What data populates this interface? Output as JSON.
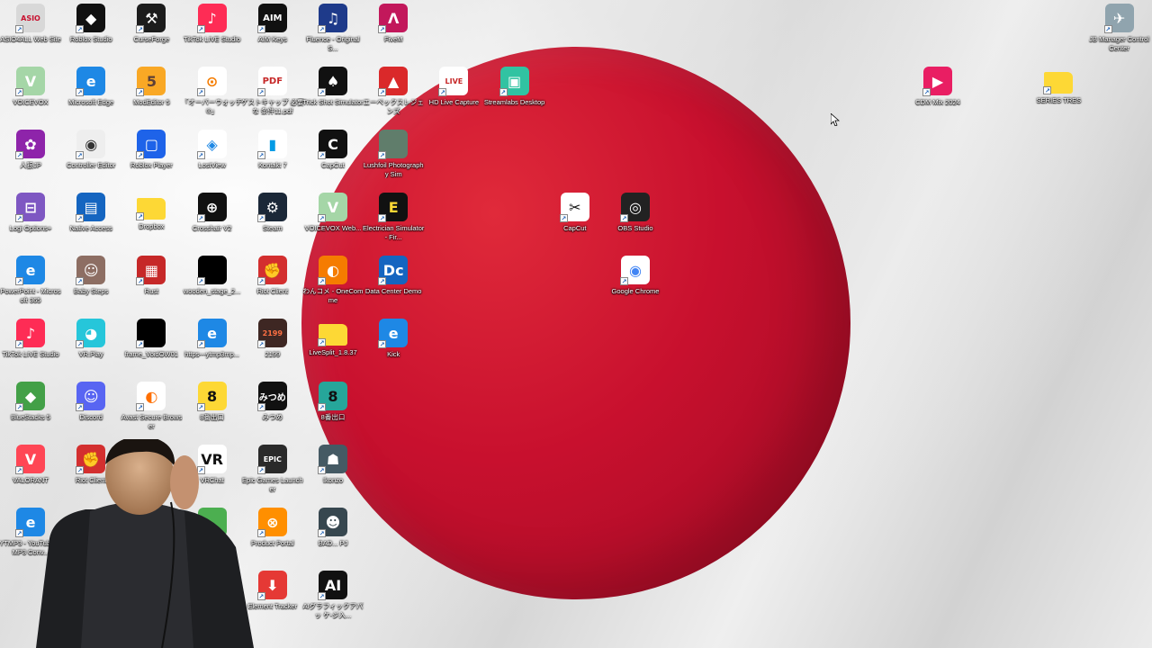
{
  "desktop": {
    "background": {
      "field_color": "#eeeeee",
      "sun_color": "#c8102e"
    },
    "icons": [
      {
        "id": "asio",
        "label": "ASIO4ALL Web Site",
        "bg": "#d8d8d8",
        "fg": "#c8102e",
        "glyph": "ASIO"
      },
      {
        "id": "roblox-studio",
        "label": "Roblox Studio",
        "bg": "#111111",
        "fg": "#ffffff",
        "glyph": "◆"
      },
      {
        "id": "curseforge",
        "label": "CurseForge",
        "bg": "#1c1c1c",
        "fg": "#ffffff",
        "glyph": "⚒"
      },
      {
        "id": "tiktok-live-studio-1",
        "label": "TikTok LIVE Studio",
        "bg": "#fe2c55",
        "fg": "#ffffff",
        "glyph": "♪"
      },
      {
        "id": "aim-keys",
        "label": "AIM Keys",
        "bg": "#111111",
        "fg": "#ffffff",
        "glyph": "AIM"
      },
      {
        "id": "fluence",
        "label": "Fluence - Original S...",
        "bg": "#1e3a8a",
        "fg": "#ffffff",
        "glyph": "♫"
      },
      {
        "id": "fiveM",
        "label": "FiveM",
        "bg": "#c2185b",
        "fg": "#ffffff",
        "glyph": "Λ"
      },
      {
        "id": "voicevox-1",
        "label": "VOICEVOX",
        "bg": "#a5d6a7",
        "fg": "#ffffff",
        "glyph": "V"
      },
      {
        "id": "msedge-1",
        "label": "Microsoft Edge",
        "bg": "#1e88e5",
        "fg": "#ffffff",
        "glyph": "e"
      },
      {
        "id": "modeditor",
        "label": "ModEditor 5",
        "bg": "#f9a825",
        "fg": "#5d4037",
        "glyph": "5"
      },
      {
        "id": "overwatch",
        "label": "「オーバーウォッチ®」",
        "bg": "#ffffff",
        "fg": "#f57c00",
        "glyph": "⊙"
      },
      {
        "id": "pdf",
        "label": "ゲストキャップ 必要な 条件11.pdf",
        "bg": "#ffffff",
        "fg": "#c62828",
        "glyph": "PDF"
      },
      {
        "id": "trickshot",
        "label": "Trick Shot Simulator",
        "bg": "#111111",
        "fg": "#ffffff",
        "glyph": "♠"
      },
      {
        "id": "apex",
        "label": "エーペックスレジェンズ",
        "bg": "#da292a",
        "fg": "#ffffff",
        "glyph": "▲"
      },
      {
        "id": "hd-live",
        "label": "HD Live Capture",
        "bg": "#ffffff",
        "fg": "#c62828",
        "glyph": "LIVE"
      },
      {
        "id": "streamlabs",
        "label": "Streamlabs Desktop",
        "bg": "#31c3a2",
        "fg": "#ffffff",
        "glyph": "▣"
      },
      {
        "id": "jinroujp",
        "label": "人狼JP",
        "bg": "#8e24aa",
        "fg": "#ffffff",
        "glyph": "✿"
      },
      {
        "id": "controller-editor",
        "label": "Controller Editor",
        "bg": "#eeeeee",
        "fg": "#333333",
        "glyph": "◉"
      },
      {
        "id": "roblox-player",
        "label": "Roblox Player",
        "bg": "#1e63e9",
        "fg": "#ffffff",
        "glyph": "▢"
      },
      {
        "id": "lostview",
        "label": "LostView",
        "bg": "#ffffff",
        "fg": "#1e88e5",
        "glyph": "◈"
      },
      {
        "id": "kontakt",
        "label": "Kontakt 7",
        "bg": "#ffffff",
        "fg": "#039be5",
        "glyph": "▮"
      },
      {
        "id": "capcut-green",
        "label": "CapCut",
        "bg": "#111111",
        "fg": "#ffffff",
        "glyph": "C"
      },
      {
        "id": "lushfoil",
        "label": "Lushfoil Photography Sim",
        "bg": "#607d6b",
        "fg": "#ffffff",
        "glyph": ""
      },
      {
        "id": "logi-options",
        "label": "Logi Options+",
        "bg": "#7e57c2",
        "fg": "#ffffff",
        "glyph": "⊟"
      },
      {
        "id": "native-access",
        "label": "Native Access",
        "bg": "#1565c0",
        "fg": "#ffffff",
        "glyph": "▤"
      },
      {
        "id": "dropbox-folder",
        "label": "Dropbox",
        "bg": "#fdd835",
        "fg": "#fdd835",
        "glyph": ""
      },
      {
        "id": "crosshair",
        "label": "Crosshair V2",
        "bg": "#111111",
        "fg": "#ffffff",
        "glyph": "⊕"
      },
      {
        "id": "steam",
        "label": "Steam",
        "bg": "#1b2838",
        "fg": "#ffffff",
        "glyph": "⚙"
      },
      {
        "id": "voicevox-web",
        "label": "VOICEVOX Web...",
        "bg": "#a5d6a7",
        "fg": "#ffffff",
        "glyph": "V"
      },
      {
        "id": "electrician",
        "label": "Electrician Simulator - Fir...",
        "bg": "#111111",
        "fg": "#fdd835",
        "glyph": "E"
      },
      {
        "id": "capcut",
        "label": "CapCut",
        "bg": "#ffffff",
        "fg": "#111111",
        "glyph": "✂"
      },
      {
        "id": "obs",
        "label": "OBS Studio",
        "bg": "#222222",
        "fg": "#ffffff",
        "glyph": "◎"
      },
      {
        "id": "ppt",
        "label": "PowerPoint - Microsoft 365",
        "bg": "#1e88e5",
        "fg": "#ffffff",
        "glyph": "e"
      },
      {
        "id": "babysteps",
        "label": "Baby Steps",
        "bg": "#8d6e63",
        "fg": "#ffffff",
        "glyph": "☺"
      },
      {
        "id": "rust",
        "label": "Rust",
        "bg": "#c62828",
        "fg": "#ffffff",
        "glyph": "▦"
      },
      {
        "id": "wooden-stage",
        "label": "wooden_stage_2...",
        "bg": "#000000",
        "fg": "#000000",
        "glyph": ""
      },
      {
        "id": "riot-client-1",
        "label": "Riot Client",
        "bg": "#d32f2f",
        "fg": "#ffffff",
        "glyph": "✊"
      },
      {
        "id": "onecomme",
        "label": "わんコメ - OneComme",
        "bg": "#f57c00",
        "fg": "#ffffff",
        "glyph": "◐"
      },
      {
        "id": "dcdemo",
        "label": "Data Center Demo",
        "bg": "#1565c0",
        "fg": "#ffffff",
        "glyph": "Dc"
      },
      {
        "id": "chrome",
        "label": "Google Chrome",
        "bg": "#ffffff",
        "fg": "#4285f4",
        "glyph": "◉"
      },
      {
        "id": "tiktok-live-studio-2",
        "label": "TikTok LIVE Studio",
        "bg": "#fe2c55",
        "fg": "#ffffff",
        "glyph": "♪"
      },
      {
        "id": "vrplay",
        "label": "VR.Play",
        "bg": "#26c6da",
        "fg": "#ffffff",
        "glyph": "◕"
      },
      {
        "id": "black-file",
        "label": "frame_VoidOW01",
        "bg": "#000000",
        "fg": "#000000",
        "glyph": ""
      },
      {
        "id": "edge-link",
        "label": "https---ytmp3mp...",
        "bg": "#1e88e5",
        "fg": "#ffffff",
        "glyph": "e"
      },
      {
        "id": "game2199",
        "label": "2199",
        "bg": "#3e2723",
        "fg": "#ff7043",
        "glyph": "2199"
      },
      {
        "id": "livesplit",
        "label": "LiveSplit_1.8.37",
        "bg": "#fdd835",
        "fg": "#fdd835",
        "glyph": ""
      },
      {
        "id": "kick",
        "label": "Kick",
        "bg": "#1e88e5",
        "fg": "#ffffff",
        "glyph": "e"
      },
      {
        "id": "bluestacks",
        "label": "BlueStacks 5",
        "bg": "#43a047",
        "fg": "#ffffff",
        "glyph": "◆"
      },
      {
        "id": "discord",
        "label": "Discord",
        "bg": "#5865f2",
        "fg": "#ffffff",
        "glyph": "☺"
      },
      {
        "id": "avast",
        "label": "Avast Secure Browser",
        "bg": "#ffffff",
        "fg": "#ff6f00",
        "glyph": "◐"
      },
      {
        "id": "exit8-1",
        "label": "8番出口",
        "bg": "#fdd835",
        "fg": "#111111",
        "glyph": "8"
      },
      {
        "id": "mitsume",
        "label": "みつめ",
        "bg": "#111111",
        "fg": "#ffffff",
        "glyph": "みつめ"
      },
      {
        "id": "exit8-2",
        "label": "8番出口",
        "bg": "#26a69a",
        "fg": "#111111",
        "glyph": "8"
      },
      {
        "id": "valorant",
        "label": "VALORANT",
        "bg": "#ff4655",
        "fg": "#ffffff",
        "glyph": "V"
      },
      {
        "id": "riot-client-2",
        "label": "Riot Client",
        "bg": "#d32f2f",
        "fg": "#ffffff",
        "glyph": "✊"
      },
      {
        "id": "vrchat",
        "label": "VRChat",
        "bg": "#ffffff",
        "fg": "#111111",
        "glyph": "VR"
      },
      {
        "id": "epic",
        "label": "Epic Games Launcher",
        "bg": "#2a2a2a",
        "fg": "#ffffff",
        "glyph": "EPIC"
      },
      {
        "id": "ikonzo",
        "label": "Ikonzo",
        "bg": "#455a64",
        "fg": "#ffffff",
        "glyph": "☗"
      },
      {
        "id": "ytmp3",
        "label": "YTMP3 - YouTube to MP3 Conv...",
        "bg": "#1e88e5",
        "fg": "#ffffff",
        "glyph": "e"
      },
      {
        "id": "product-green",
        "label": "",
        "bg": "#4caf50",
        "fg": "#ffffff",
        "glyph": ""
      },
      {
        "id": "product-orange",
        "label": "Product Portal",
        "bg": "#ff8f00",
        "fg": "#ffffff",
        "glyph": "⊗"
      },
      {
        "id": "bad-guy",
        "label": "BAD... PJ",
        "bg": "#37474f",
        "fg": "#ffffff",
        "glyph": "☻"
      },
      {
        "id": "elements",
        "label": "Element Tracker",
        "bg": "#e53935",
        "fg": "#ffffff",
        "glyph": "⬇"
      },
      {
        "id": "ai-tool",
        "label": "AIグラフィックアパッ ケ-ジ入...",
        "bg": "#111111",
        "fg": "#ffffff",
        "glyph": "AI"
      },
      {
        "id": "cdm-mix",
        "label": "CDM Mix 2024",
        "bg": "#e91e63",
        "fg": "#ffffff",
        "glyph": "▶"
      },
      {
        "id": "folder-tr",
        "label": "SERIES TRES",
        "bg": "#fdd835",
        "fg": "#fdd835",
        "glyph": ""
      },
      {
        "id": "jbmanager",
        "label": "JB Manager Control Center",
        "bg": "#90a4ae",
        "fg": "#ffffff",
        "glyph": "✈"
      }
    ]
  }
}
